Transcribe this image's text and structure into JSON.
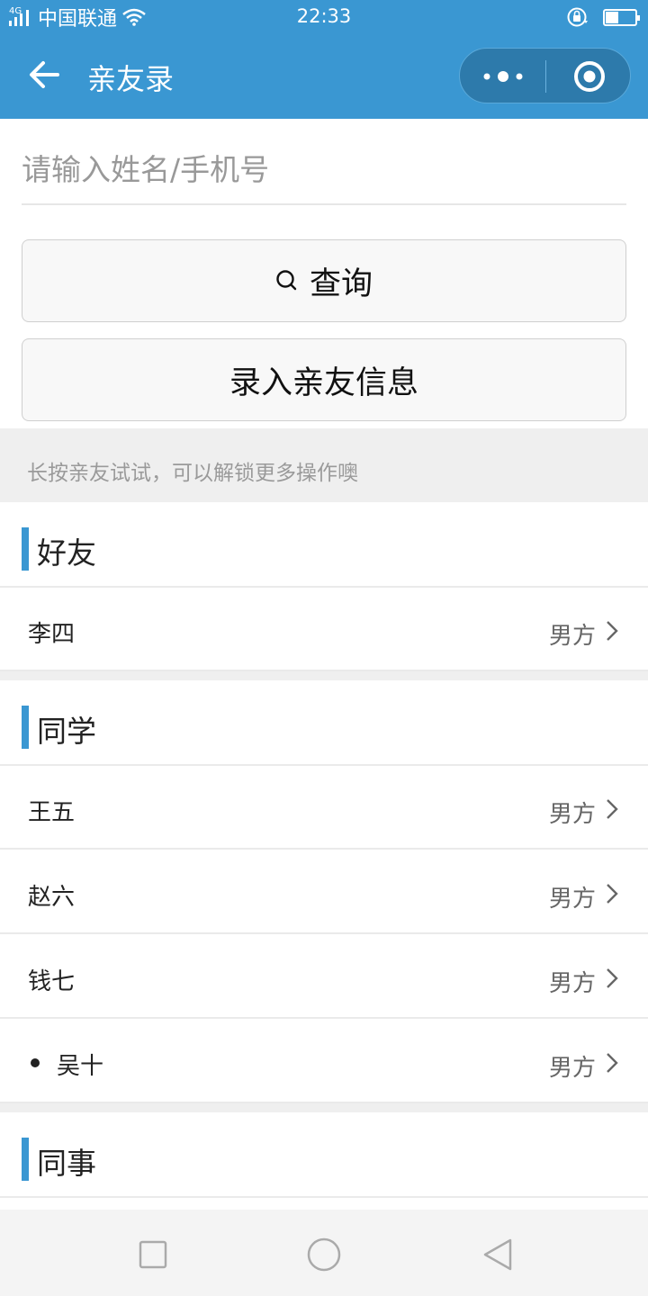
{
  "status_bar": {
    "network": "4G",
    "carrier": "中国联通",
    "time": "22:33",
    "battery_level": 0.45
  },
  "nav": {
    "title": "亲友录",
    "back_icon": "arrow-left-icon",
    "more_icon": "more-dots-icon",
    "close_icon": "target-circle-icon",
    "accent_color": "#3a97d2"
  },
  "search": {
    "placeholder": "请输入姓名/手机号",
    "value": ""
  },
  "buttons": {
    "query_label": "查询",
    "add_label": "录入亲友信息"
  },
  "hint": "长按亲友试试，可以解锁更多操作噢",
  "groups": [
    {
      "title": "好友",
      "items": [
        {
          "name": "李四",
          "tag": "男方"
        }
      ]
    },
    {
      "title": "同学",
      "items": [
        {
          "name": "王五",
          "tag": "男方"
        },
        {
          "name": "赵六",
          "tag": "男方"
        },
        {
          "name": "钱七",
          "tag": "男方"
        },
        {
          "name": "吴十",
          "tag": "男方",
          "bullet": true
        }
      ]
    },
    {
      "title": "同事",
      "items": []
    }
  ],
  "system_nav": {
    "recent_icon": "square-icon",
    "home_icon": "circle-icon",
    "back_icon": "triangle-back-icon"
  }
}
